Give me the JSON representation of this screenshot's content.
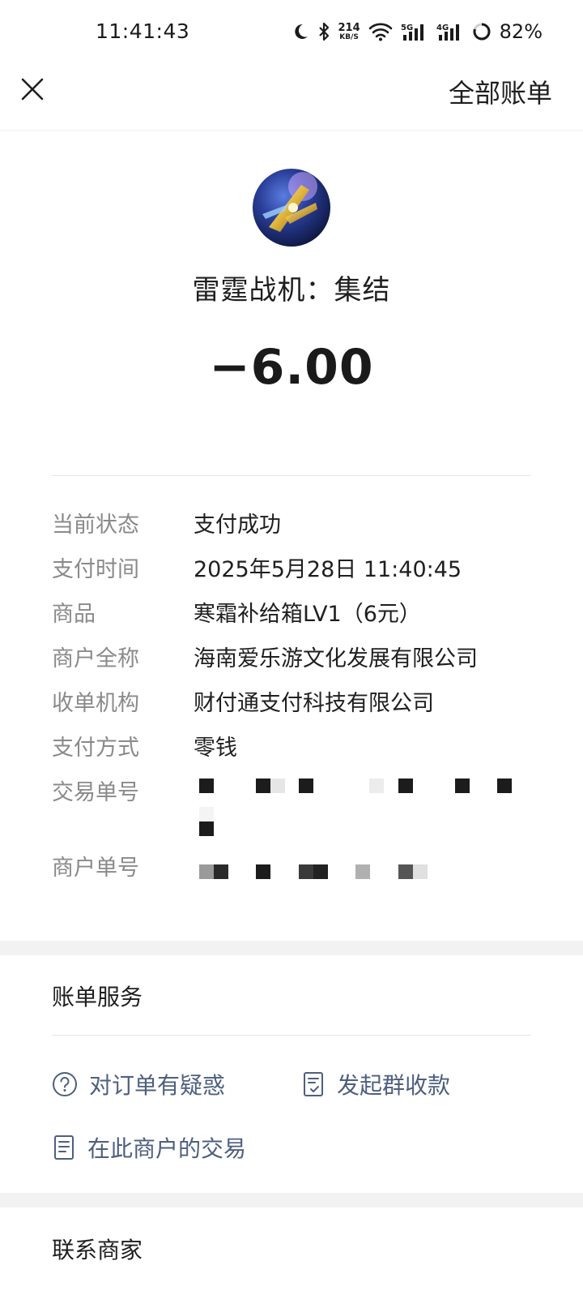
{
  "status_bar": {
    "time": "11:41:43",
    "net_speed_value": "214",
    "net_speed_unit": "KB/S",
    "battery": "82%",
    "icons": [
      "moon-icon",
      "bluetooth-icon",
      "wifi-icon",
      "signal-5g-icon",
      "signal-4g-icon",
      "battery-ring-icon"
    ]
  },
  "nav": {
    "close_icon": "close-icon",
    "all_bills": "全部账单"
  },
  "merchant": {
    "name": "雷霆战机：集结",
    "amount": "−6.00"
  },
  "details": [
    {
      "label": "当前状态",
      "value": "支付成功"
    },
    {
      "label": "支付时间",
      "value": "2025年5月28日 11:40:45"
    },
    {
      "label": "商品",
      "value": "寒霜补给箱LV1（6元）"
    },
    {
      "label": "商户全称",
      "value": "海南爱乐游文化发展有限公司"
    },
    {
      "label": "收单机构",
      "value": "财付通支付科技有限公司"
    },
    {
      "label": "支付方式",
      "value": "零钱"
    },
    {
      "label": "交易单号",
      "value": ""
    },
    {
      "label": "商户单号",
      "value": ""
    }
  ],
  "bill_service": {
    "title": "账单服务",
    "links": {
      "order_question": "对订单有疑惑",
      "group_collect": "发起群收款",
      "merchant_transactions": "在此商户的交易"
    }
  },
  "contact": {
    "title": "联系商家"
  },
  "colors": {
    "link": "#4e5f7f",
    "label": "#8a8a8a",
    "section_gap": "#f2f2f2"
  }
}
